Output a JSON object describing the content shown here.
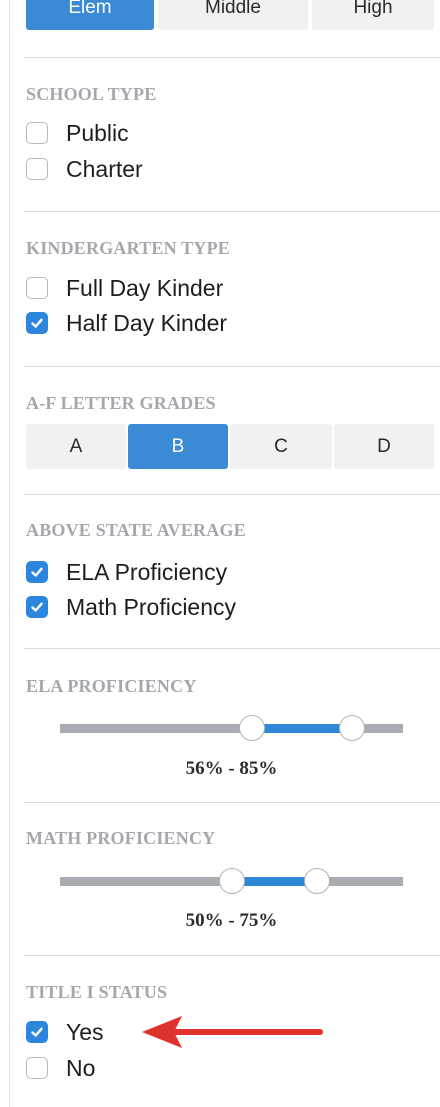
{
  "level_selector": {
    "options": [
      {
        "label": "Elem",
        "active": true
      },
      {
        "label": "Middle",
        "active": false
      },
      {
        "label": "High",
        "active": false
      }
    ]
  },
  "school_type": {
    "title": "SCHOOL TYPE",
    "options": [
      {
        "label": "Public",
        "checked": false
      },
      {
        "label": "Charter",
        "checked": false
      }
    ]
  },
  "kindergarten_type": {
    "title": "KINDERGARTEN TYPE",
    "options": [
      {
        "label": "Full Day Kinder",
        "checked": false
      },
      {
        "label": "Half Day Kinder",
        "checked": true
      }
    ]
  },
  "letter_grades": {
    "title": "A-F LETTER GRADES",
    "options": [
      {
        "label": "A",
        "active": false
      },
      {
        "label": "B",
        "active": true
      },
      {
        "label": "C",
        "active": false
      },
      {
        "label": "D",
        "active": false
      }
    ]
  },
  "above_state_average": {
    "title": "ABOVE STATE AVERAGE",
    "options": [
      {
        "label": "ELA Proficiency",
        "checked": true
      },
      {
        "label": "Math Proficiency",
        "checked": true
      }
    ]
  },
  "ela_proficiency": {
    "title": "ELA PROFICIENCY",
    "min": 56,
    "max": 85,
    "readout": "56% - 85%"
  },
  "math_proficiency": {
    "title": "MATH PROFICIENCY",
    "min": 50,
    "max": 75,
    "readout": "50% - 75%"
  },
  "title_i_status": {
    "title": "TITLE I STATUS",
    "options": [
      {
        "label": "Yes",
        "checked": true
      },
      {
        "label": "No",
        "checked": false
      }
    ]
  },
  "colors": {
    "accent": "#3a8ad6",
    "slider_track": "#a9acb0",
    "section_title": "#a4a8ad",
    "annotation_arrow": "#e0322c"
  },
  "icons": {
    "checkmark": "check-icon",
    "annotation": "red-arrow-icon"
  }
}
